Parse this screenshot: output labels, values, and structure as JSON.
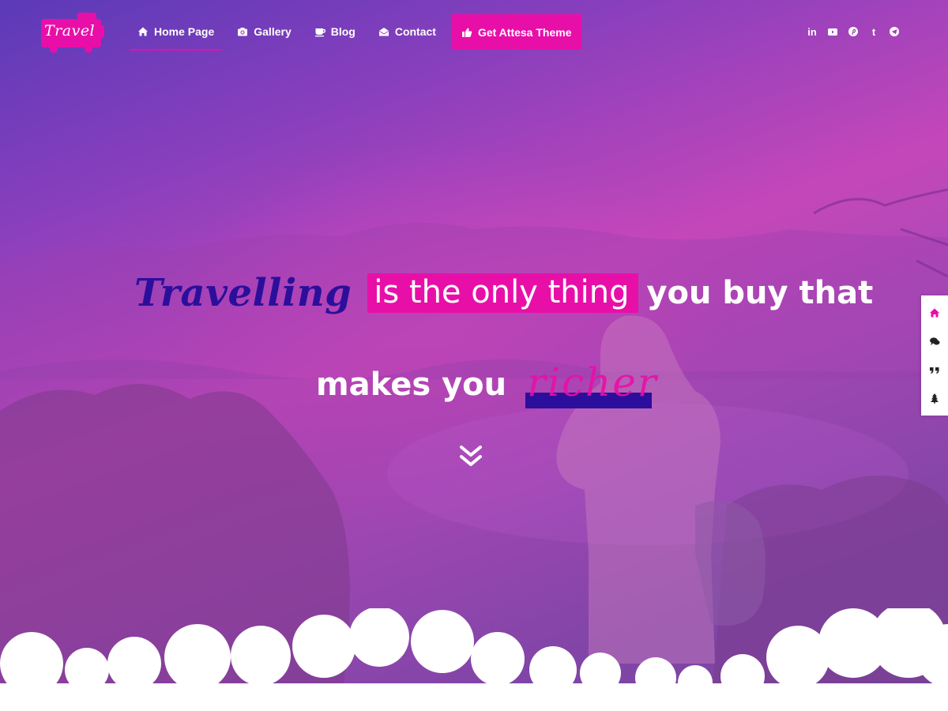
{
  "header": {
    "logo": {
      "text": "Travel",
      "icon": "van-logo"
    },
    "nav": [
      {
        "label": "Home Page",
        "icon": "home-icon",
        "active": true
      },
      {
        "label": "Gallery",
        "icon": "camera-icon",
        "active": false
      },
      {
        "label": "Blog",
        "icon": "coffee-icon",
        "active": false
      },
      {
        "label": "Contact",
        "icon": "envelope-open-icon",
        "active": false
      }
    ],
    "cta": {
      "label": "Get Attesa Theme",
      "icon": "thumbs-up-icon"
    },
    "social": [
      {
        "name": "linkedin-icon",
        "glyph": "in"
      },
      {
        "name": "youtube-icon",
        "glyph": "▶"
      },
      {
        "name": "pinterest-icon",
        "glyph": "P"
      },
      {
        "name": "tumblr-icon",
        "glyph": "t"
      },
      {
        "name": "telegram-icon",
        "glyph": "➤"
      }
    ]
  },
  "hero": {
    "word_script": "Travelling",
    "word_highlight": "is the only thing",
    "word_white": "you buy that",
    "line2_white": "makes you",
    "line2_script": "richer"
  },
  "side_dock": [
    "home-icon",
    "comments-icon",
    "quote-icon",
    "tree-icon"
  ],
  "colors": {
    "accent": "#e80fa8",
    "deep_blue": "#2b0f9c",
    "white": "#ffffff",
    "gradient_top": "#5b3ab8",
    "gradient_mid": "#c447b9"
  }
}
